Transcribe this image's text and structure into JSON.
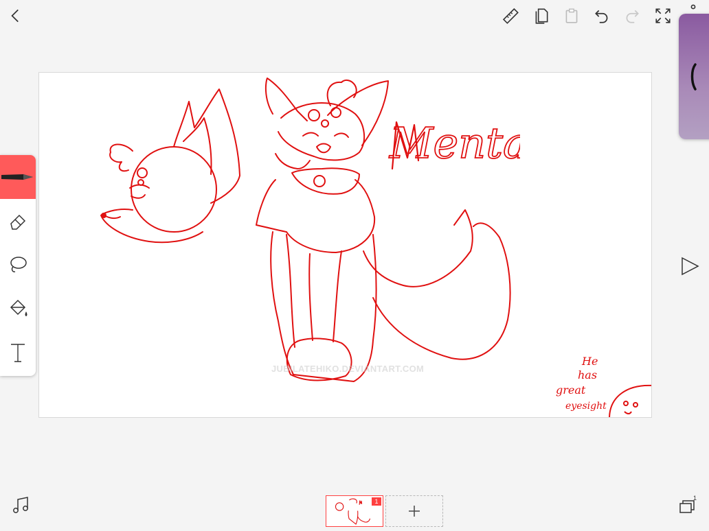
{
  "top_toolbar": {
    "back": "back-icon",
    "ruler": "ruler-icon",
    "copy": "copy-icon",
    "paste": "paste-icon",
    "undo": "undo-icon",
    "redo": "redo-icon",
    "fullscreen": "fullscreen-icon",
    "more": "more-icon"
  },
  "tools": [
    {
      "name": "pen",
      "icon": "pen-icon",
      "active": true
    },
    {
      "name": "eraser",
      "icon": "eraser-icon",
      "active": false
    },
    {
      "name": "lasso",
      "icon": "lasso-icon",
      "active": false
    },
    {
      "name": "fill",
      "icon": "fill-bucket-icon",
      "active": false
    },
    {
      "name": "text",
      "icon": "text-icon",
      "active": false
    }
  ],
  "colors": {
    "active_tool": "#ff5a5a",
    "drawing_stroke": "#e01010",
    "color_panel": "#9a72ad",
    "selected_frame": "#ff4040"
  },
  "canvas": {
    "title_text": "Mentats",
    "note_text": [
      "He",
      "has",
      "great",
      "eyesight"
    ],
    "watermark": "JUBILATEHIKO.DEVIANTART.COM"
  },
  "timeline": {
    "frames": [
      {
        "number": "1",
        "selected": true
      }
    ],
    "add_frame_icon": "plus-icon"
  },
  "bottom": {
    "music": "music-note-icon",
    "layers": "layers-icon",
    "layers_count": "1",
    "play": "play-icon"
  }
}
